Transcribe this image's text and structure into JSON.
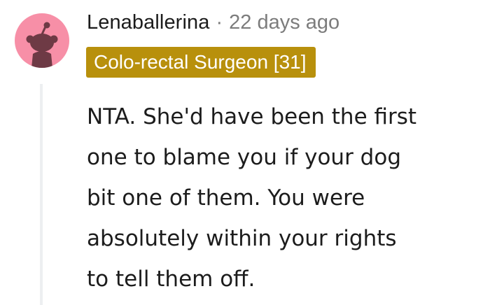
{
  "comment": {
    "username": "Lenaballerina",
    "separator": "·",
    "timestamp": "22 days ago",
    "flair": "Colo-rectal Surgeon [31]",
    "body_lines": [
      "NTA. She'd have been the first",
      "one to blame you if your dog",
      "bit one of them. You were",
      "absolutely within your rights",
      "to tell them off."
    ]
  },
  "colors": {
    "avatar_background": "#f78fa7",
    "avatar_snoo": "#6e3a45",
    "flair_background": "#b8900c",
    "flair_text": "#ffffff",
    "text": "#1c1c1c",
    "muted": "#7c7c7c",
    "thread_line": "#edeff1"
  },
  "icons": {
    "avatar": "snoo-avatar-icon"
  }
}
